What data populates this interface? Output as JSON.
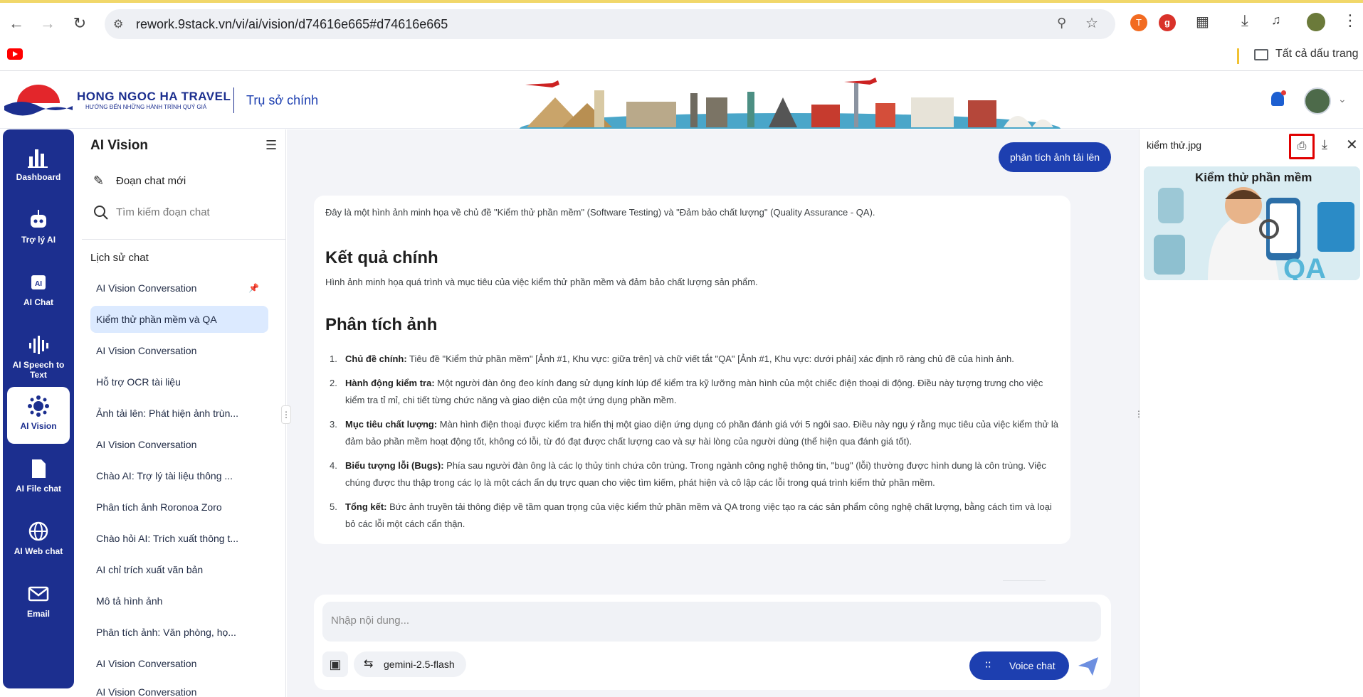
{
  "browser": {
    "url": "rework.9stack.vn/vi/ai/vision/d74616e665#d74616e665",
    "bookmarks_folder": "Tất cả dấu trang"
  },
  "header": {
    "brand_name": "HONG NGOC HA TRAVEL",
    "brand_tagline": "HƯỚNG ĐẾN NHỮNG HÀNH TRÌNH QUÝ GIÁ",
    "office": "Trụ sở chính"
  },
  "rail": {
    "items": [
      {
        "label": "Dashboard",
        "icon": "bar-chart-icon"
      },
      {
        "label": "Trợ lý AI",
        "icon": "robot-icon"
      },
      {
        "label": "AI Chat",
        "icon": "ai-chip-icon"
      },
      {
        "label": "AI Speech to Text",
        "icon": "soundwave-icon"
      },
      {
        "label": "AI Vision",
        "icon": "vision-icon"
      },
      {
        "label": "AI File chat",
        "icon": "file-icon"
      },
      {
        "label": "AI Web chat",
        "icon": "globe-icon"
      },
      {
        "label": "Email",
        "icon": "mail-icon"
      }
    ]
  },
  "chat_panel": {
    "title": "AI Vision",
    "new_chat": "Đoạn chat mới",
    "search_placeholder": "Tìm kiếm đoạn chat",
    "history_title": "Lịch sử chat",
    "history": [
      "AI Vision Conversation",
      "Kiểm thử phần mềm và QA",
      "AI Vision Conversation",
      "Hỗ trợ OCR tài liệu",
      "Ảnh tải lên: Phát hiện ảnh trùn...",
      "AI Vision Conversation",
      "Chào AI: Trợ lý tài liệu thông ...",
      "Phân tích ảnh Roronoa Zoro",
      "Chào hỏi AI: Trích xuất thông t...",
      "AI chỉ trích xuất văn bản",
      "Mô tả hình ảnh",
      "Phân tích ảnh: Văn phòng, họ...",
      "AI Vision Conversation",
      "AI Vision Conversation"
    ]
  },
  "conversation": {
    "user_message": "phân tích ảnh tải lên",
    "intro": "Đây là một hình ảnh minh họa về chủ đề \"Kiểm thử phần mềm\" (Software Testing) và \"Đảm bảo chất lượng\" (Quality Assurance - QA).",
    "result_heading": "Kết quả chính",
    "result_text": "Hình ảnh minh họa quá trình và mục tiêu của việc kiểm thử phần mềm và đảm bảo chất lượng sản phẩm.",
    "analysis_heading": "Phân tích ảnh",
    "analysis": [
      {
        "num": "1.",
        "title": "Chủ đề chính:",
        "text": " Tiêu đề \"Kiểm thử phần mềm\" [Ảnh #1, Khu vực: giữa trên] và chữ viết tắt \"QA\" [Ảnh #1, Khu vực: dưới phải] xác định rõ ràng chủ đề của hình ảnh."
      },
      {
        "num": "2.",
        "title": "Hành động kiểm tra:",
        "text": " Một người đàn ông đeo kính đang sử dụng kính lúp để kiểm tra kỹ lưỡng màn hình của một chiếc điện thoại di động. Điều này tượng trưng cho việc kiểm tra tỉ mỉ, chi tiết từng chức năng và giao diện của một ứng dụng phần mềm."
      },
      {
        "num": "3.",
        "title": "Mục tiêu chất lượng:",
        "text": " Màn hình điện thoại được kiểm tra hiển thị một giao diện ứng dụng có phần đánh giá với 5 ngôi sao. Điều này ngụ ý rằng mục tiêu của việc kiểm thử là đảm bảo phần mềm hoạt động tốt, không có lỗi, từ đó đạt được chất lượng cao và sự hài lòng của người dùng (thể hiện qua đánh giá tốt)."
      },
      {
        "num": "4.",
        "title": "Biểu tượng lỗi (Bugs):",
        "text": " Phía sau người đàn ông là các lọ thủy tinh chứa côn trùng. Trong ngành công nghệ thông tin, \"bug\" (lỗi) thường được hình dung là côn trùng. Việc chúng được thu thập trong các lọ là một cách ẩn dụ trực quan cho việc tìm kiếm, phát hiện và cô lập các lỗi trong quá trình kiểm thử phần mềm."
      },
      {
        "num": "5.",
        "title": "Tổng kết:",
        "text": " Bức ảnh truyền tải thông điệp về tầm quan trọng của việc kiểm thử phần mềm và QA trong việc tạo ra các sản phẩm công nghệ chất lượng, bằng cách tìm và loại bỏ các lỗi một cách cẩn thận."
      }
    ]
  },
  "composer": {
    "placeholder": "Nhập nội dung...",
    "model": "gemini-2.5-flash",
    "voice_label": "Voice chat"
  },
  "preview": {
    "filename": "kiểm thử.jpg",
    "image_title": "Kiểm thử phần mềm",
    "image_tag": "QA"
  },
  "colors": {
    "brand_blue": "#1c2f8f",
    "accent_blue": "#1d3fb0",
    "active_bg": "#dceaff",
    "highlight_red": "#e00000"
  }
}
